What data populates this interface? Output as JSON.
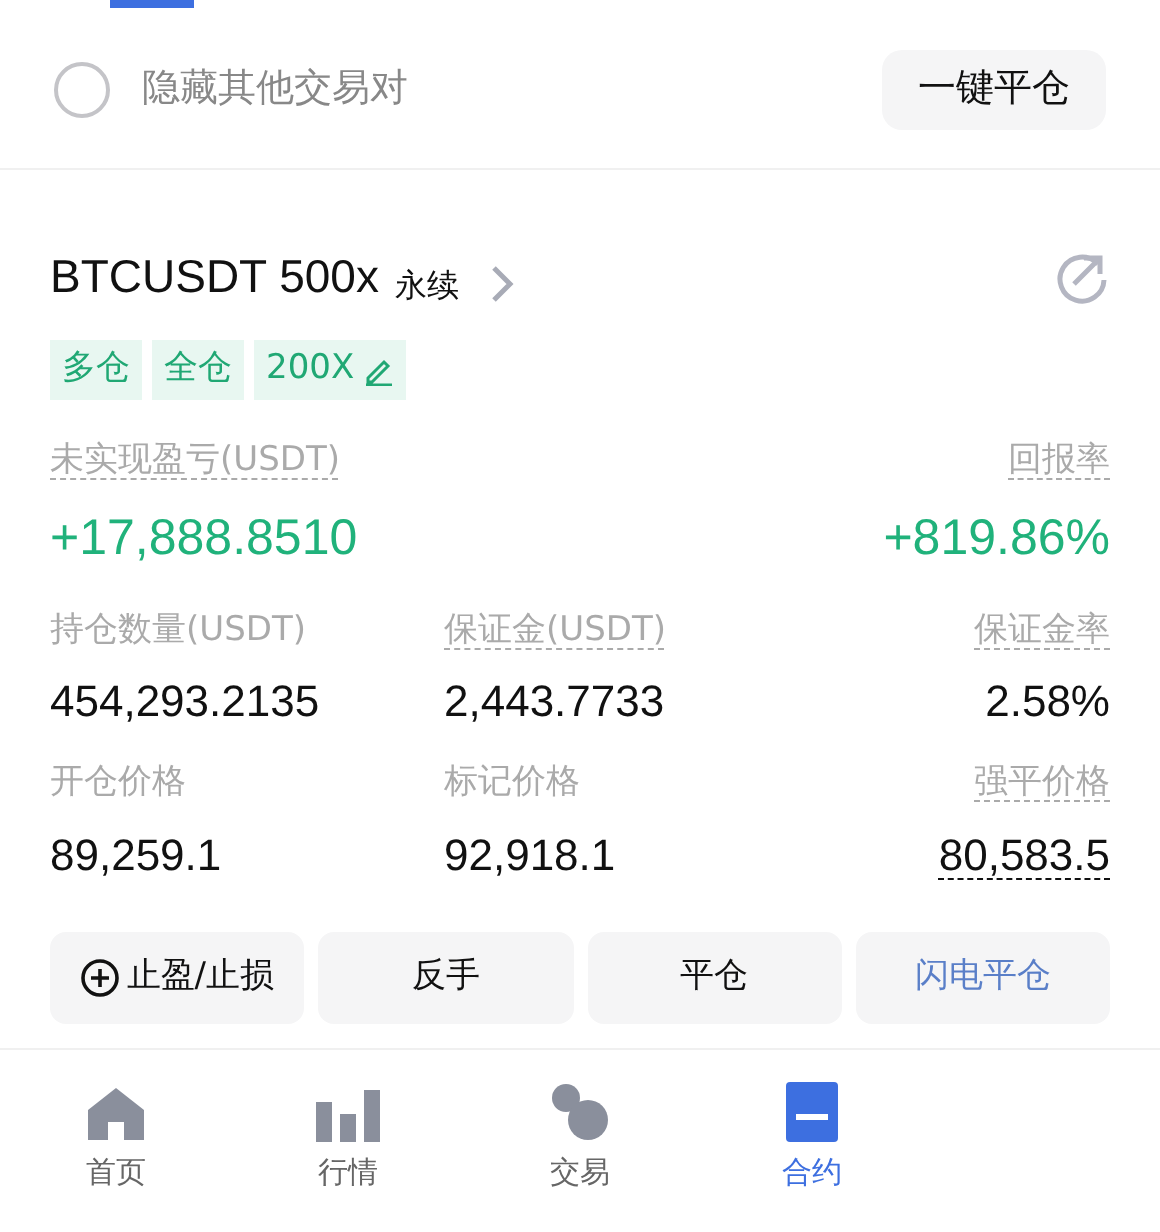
{
  "filter": {
    "label": "隐藏其他交易对",
    "checked": false
  },
  "close_all_button": "一键平仓",
  "position": {
    "symbol": "BTCUSDT 500x",
    "type": "永续",
    "tags": [
      {
        "kind": "text",
        "label": "多仓"
      },
      {
        "kind": "text",
        "label": "全仓"
      },
      {
        "kind": "editable",
        "label": "200X"
      }
    ],
    "pnl": {
      "label": "未实现盈亏(USDT)",
      "value": "+17,888.8510",
      "underlined": true
    },
    "roe": {
      "label": "回报率",
      "value": "+819.86%",
      "underlined": true
    },
    "fields": [
      {
        "label": "持仓数量(USDT)",
        "value": "454,293.2135",
        "label_underlined": false,
        "value_underlined": false
      },
      {
        "label": "保证金(USDT)",
        "value": "2,443.7733",
        "label_underlined": true,
        "value_underlined": false
      },
      {
        "label": "保证金率",
        "value": "2.58%",
        "label_underlined": true,
        "value_underlined": false
      },
      {
        "label": "开仓价格",
        "value": "89,259.1",
        "label_underlined": false,
        "value_underlined": false
      },
      {
        "label": "标记价格",
        "value": "92,918.1",
        "label_underlined": false,
        "value_underlined": false
      },
      {
        "label": "强平价格",
        "value": "80,583.5",
        "label_underlined": true,
        "value_underlined": true
      }
    ],
    "actions": [
      {
        "kind": "add",
        "label": "止盈/止损"
      },
      {
        "kind": "plain",
        "label": "反手"
      },
      {
        "kind": "plain",
        "label": "平仓"
      },
      {
        "kind": "accent",
        "label": "闪电平仓"
      }
    ]
  },
  "nav": [
    {
      "kind": "home",
      "label": "首页",
      "selected": false
    },
    {
      "kind": "market",
      "label": "行情",
      "selected": false
    },
    {
      "kind": "trade",
      "label": "交易",
      "selected": false
    },
    {
      "kind": "contract",
      "label": "合约",
      "selected": true
    }
  ]
}
